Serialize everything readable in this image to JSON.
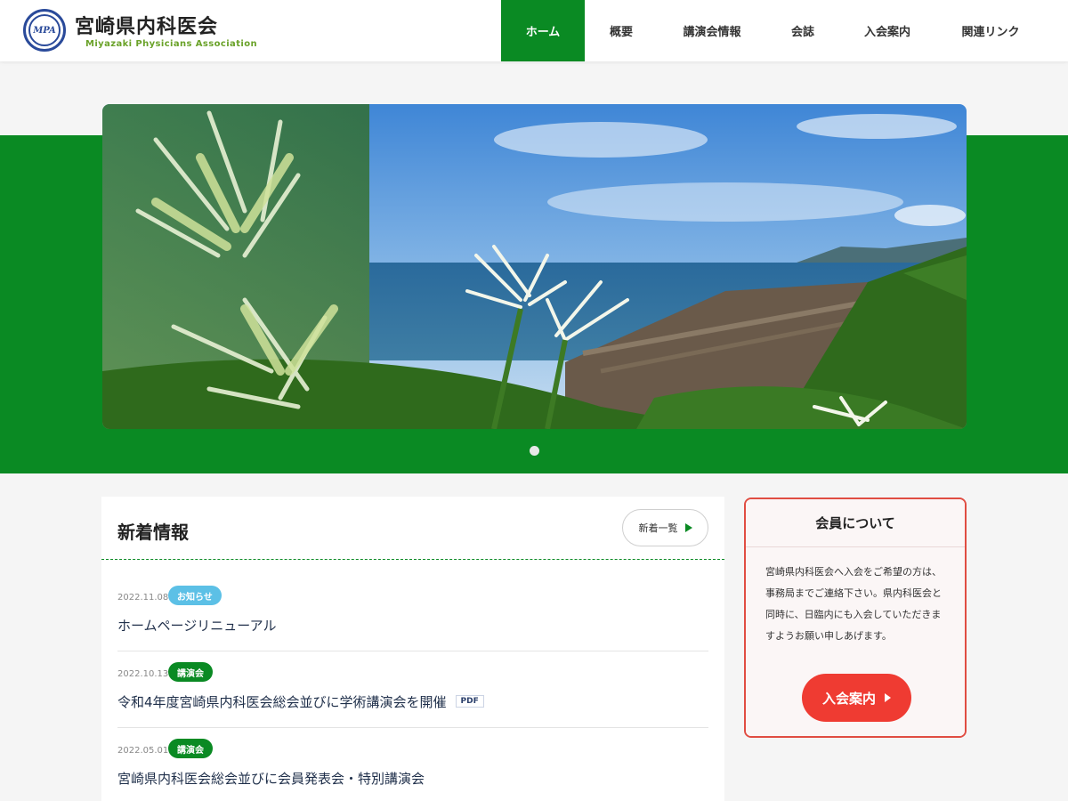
{
  "header": {
    "logo_text": "MPA",
    "title": "宮崎県内科医会",
    "subtitle": "Miyazaki Physicians Association"
  },
  "nav": {
    "items": [
      {
        "label": "ホーム",
        "active": true
      },
      {
        "label": "概要"
      },
      {
        "label": "講演会情報"
      },
      {
        "label": "会誌"
      },
      {
        "label": "入会案内"
      },
      {
        "label": "関連リンク"
      }
    ]
  },
  "hero": {
    "slides_count": 1,
    "active_slide": 1
  },
  "news": {
    "title": "新着情報",
    "more_label": "新着一覧",
    "items": [
      {
        "date": "2022.11.08",
        "tag": "お知らせ",
        "tag_color": "#5cc0e6",
        "title": "ホームページリニューアル",
        "pdf": ""
      },
      {
        "date": "2022.10.13",
        "tag": "講演会",
        "tag_color": "#0a8a23",
        "title": "令和4年度宮崎県内科医会総会並びに学術講演会を開催",
        "pdf": "PDF"
      },
      {
        "date": "2022.05.01",
        "tag": "講演会",
        "tag_color": "#0a8a23",
        "title": "宮崎県内科医会総会並びに会員発表会・特別講演会",
        "pdf": ""
      }
    ]
  },
  "member": {
    "title": "会員について",
    "text": "宮崎県内科医会へ入会をご希望の方は、事務局までご連絡下さい。県内科医会と同時に、日臨内にも入会していただきますようお願い申しあげます。",
    "button_label": "入会案内"
  },
  "colors": {
    "brand_green": "#0a8a23",
    "accent_red": "#ef3b32",
    "info_blue": "#5cc0e6"
  }
}
